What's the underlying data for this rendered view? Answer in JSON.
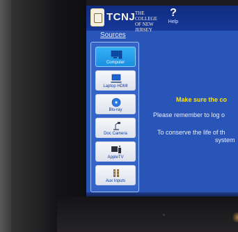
{
  "header": {
    "logo_text": "TCNJ",
    "logo_subtext": "THE COLLEGE OF NEW JERSEY",
    "help_icon": "?",
    "help_label": "Help"
  },
  "nav": {
    "sources_label": "Sources"
  },
  "sources": [
    {
      "label": "Computer",
      "icon": "computer-icon",
      "active": true
    },
    {
      "label": "Laptop HDMI",
      "icon": "laptop-icon",
      "active": false
    },
    {
      "label": "Blu-ray",
      "icon": "disc-icon",
      "active": false
    },
    {
      "label": "Doc Camera",
      "icon": "document-camera-icon",
      "active": false
    },
    {
      "label": "AppleTV",
      "icon": "apple-tv-icon",
      "active": false
    },
    {
      "label": "Aux Inputs",
      "icon": "aux-inputs-icon",
      "active": false
    }
  ],
  "messages": {
    "warning": "Make sure the co",
    "line1": "Please remember to log o",
    "line2": "To conserve the life of th",
    "line3": "system"
  },
  "colors": {
    "screen_bg": "#2a55b8",
    "header_bg": "#0f2c80",
    "warning_text": "#ffe300",
    "active_source": "#1b8ee0"
  }
}
